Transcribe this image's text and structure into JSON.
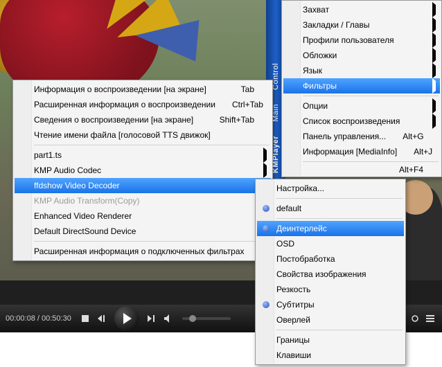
{
  "sidebar": {
    "brand": "KMPlayer",
    "section1": "Main",
    "section2": "Control"
  },
  "playback": {
    "position": "00:00:08",
    "duration": "00:50:30"
  },
  "mainMenu": {
    "capture": "Захват",
    "bookmarks": "Закладки / Главы",
    "profiles": "Профили пользователя",
    "covers": "Обложки",
    "language": "Язык",
    "filters": "Фильтры",
    "options": "Опции",
    "playlist": "Список воспроизведения",
    "ctrlPanel": "Панель управления...",
    "ctrlPanel_sc": "Alt+G",
    "mediaInfo": "Информация [MediaInfo]",
    "mediaInfo_sc": "Alt+J",
    "exit_sc": "Alt+F4"
  },
  "filtersMenu": {
    "osdInfo": "Информация о воспроизведении [на экране]",
    "osdInfo_sc": "Tab",
    "extInfo": "Расширенная информация о воспроизведении",
    "extInfo_sc": "Ctrl+Tab",
    "playInfo": "Сведения о воспроизведении [на экране]",
    "playInfo_sc": "Shift+Tab",
    "ttsName": "Чтение имени файла [голосовой TTS движок]",
    "file": "part1.ts",
    "kmpAudio": "KMP Audio Codec",
    "ffdshow": "ffdshow Video Decoder",
    "kmpAudioTr": "KMP Audio Transform(Copy)",
    "evr": "Enhanced Video Renderer",
    "dsound": "Default DirectSound Device",
    "connInfo": "Расширенная информация о подключенных фильтрах"
  },
  "ffdMenu": {
    "config": "Настройка...",
    "default": "default",
    "deint": "Деинтерлейс",
    "osd": "OSD",
    "postproc": "Постобработка",
    "imgprops": "Свойства изображения",
    "sharp": "Резкость",
    "subs": "Субтитры",
    "overlay": "Оверлей",
    "borders": "Границы",
    "keys": "Клавиши"
  }
}
